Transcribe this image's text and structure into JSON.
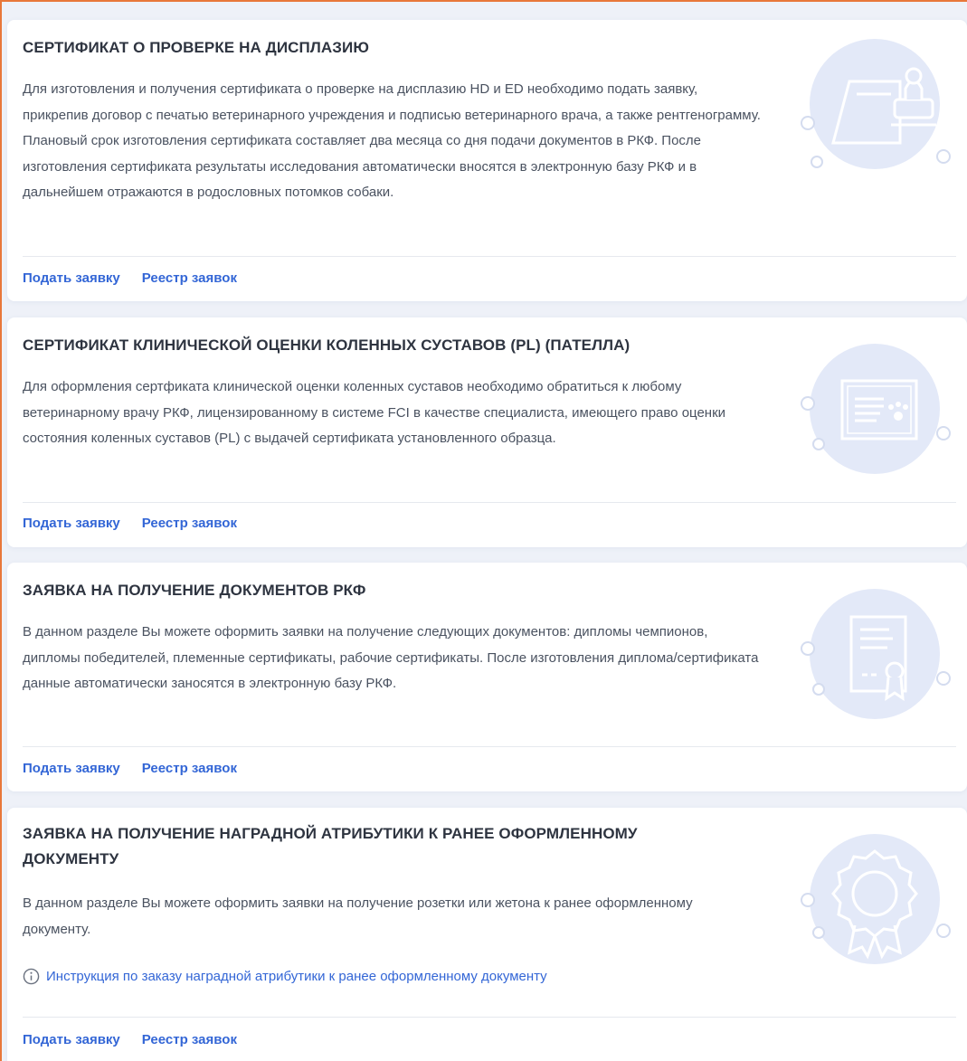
{
  "actions": {
    "apply_label": "Подать заявку",
    "registry_label": "Реестр заявок"
  },
  "cards": [
    {
      "title": "СЕРТИФИКАТ О ПРОВЕРКЕ НА ДИСПЛАЗИЮ",
      "text": "Для изготовления и получения сертификата о проверке на дисплазию HD и ED необходимо подать заявку, прикрепив договор с печатью ветеринарного учреждения и подписью ветеринарного врача, а также рентгенограмму. Плановый срок изготовления сертификата составляет два месяца со дня подачи документов в РКФ. После изготовления сертификата результаты исследования автоматически вносятся в электронную базу РКФ и в дальнейшем отражаются в родословных потомков собаки.",
      "icon": "stamp-document-icon"
    },
    {
      "title": "СЕРТИФИКАТ КЛИНИЧЕСКОЙ ОЦЕНКИ КОЛЕННЫХ СУСТАВОВ (PL) (ПАТЕЛЛА)",
      "text": "Для оформления сертфиката клинической оценки коленных суставов необходимо обратиться к любому ветеринарному врачу РКФ, лицензированному в системе FCI в качестве специалиста, имеющего право оценки состояния коленных суставов (PL) с выдачей сертификата установленного образца.",
      "icon": "paw-certificate-icon"
    },
    {
      "title": "ЗАЯВКА НА ПОЛУЧЕНИЕ ДОКУМЕНТОВ РКФ",
      "text": "В данном разделе Вы можете оформить заявки на получение следующих документов: дипломы чемпионов, дипломы победителей, племенные сертификаты, рабочие сертификаты. После изготовления диплома/сертификата данные автоматически заносятся в электронную базу РКФ.",
      "icon": "diploma-icon"
    },
    {
      "title": "ЗАЯВКА НА ПОЛУЧЕНИЕ НАГРАДНОЙ АТРИБУТИКИ К РАНЕЕ ОФОРМЛЕННОМУ ДОКУМЕНТУ",
      "text": "В данном разделе Вы можете оформить заявки на получение розетки или жетона к ранее оформленному документу.",
      "info_link": "Инструкция по заказу наградной атрибутики к ранее оформленному документу",
      "icon": "rosette-medal-icon"
    }
  ],
  "colors": {
    "accent_link": "#3366d6",
    "frame_border": "#e8773a",
    "illustration_fill": "#e3e9f8",
    "illustration_stroke": "#ffffff",
    "page_background": "#eef1f8"
  }
}
